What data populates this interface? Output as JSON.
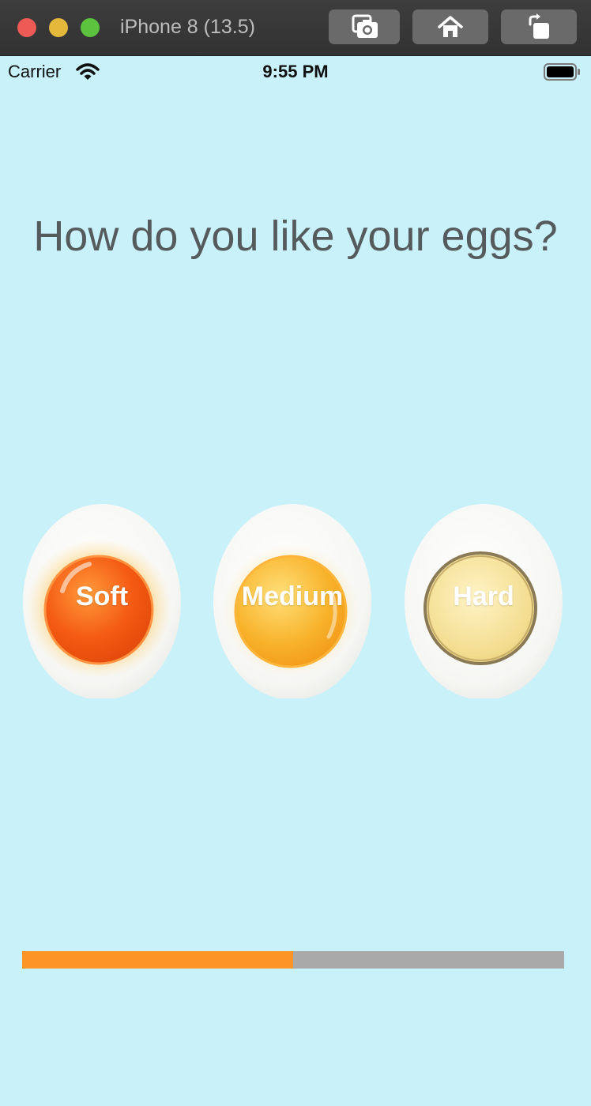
{
  "window": {
    "title": "iPhone 8 (13.5)",
    "icons": [
      "screenshot-icon",
      "home-icon",
      "rotate-icon"
    ]
  },
  "status_bar": {
    "carrier": "Carrier",
    "time": "9:55 PM"
  },
  "question": "How do you like your eggs?",
  "eggs": [
    {
      "label": "Soft",
      "yolk": "#f45a12",
      "yolk_light": "#ff9a3a"
    },
    {
      "label": "Medium",
      "yolk": "#f8b22a",
      "yolk_light": "#ffe07a"
    },
    {
      "label": "Hard",
      "yolk": "#f2dc8e",
      "yolk_light": "#fff4c6"
    }
  ],
  "progress": {
    "fraction": 0.5,
    "fill_color": "#fd9426",
    "track_color": "#a9a9a9"
  },
  "colors": {
    "background": "#c9f1fa",
    "title_text": "#555a5c"
  }
}
